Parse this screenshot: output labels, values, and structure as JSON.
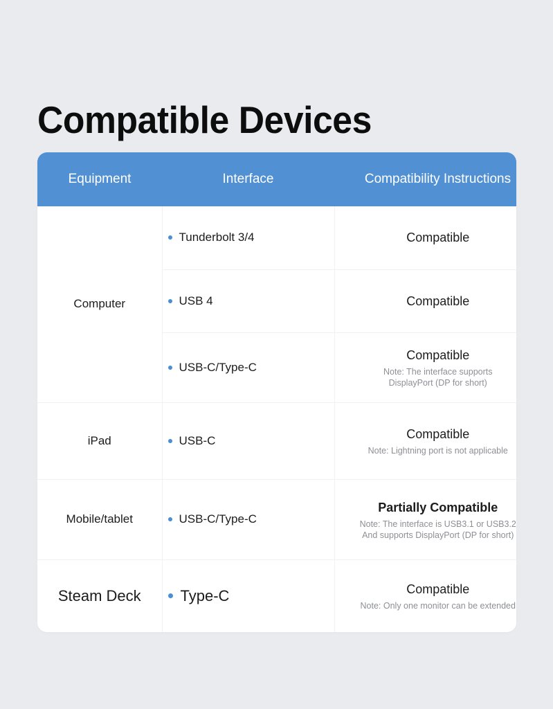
{
  "page": {
    "title": "Compatible Devices",
    "background_color": "#e9ebef"
  },
  "table": {
    "accent_color": "#5090d3",
    "bullet_color": "#4a8fd4",
    "note_color": "#8d8f94",
    "headers": {
      "equipment": "Equipment",
      "interface": "Interface",
      "compatibility": "Compatibility Instructions"
    },
    "rows": [
      {
        "equipment": "Computer",
        "equipment_rowspan": 3,
        "interfaces": [
          {
            "bullet": "bullet-icon",
            "interface": "Tunderbolt 3/4",
            "status": "Compatible",
            "note": ""
          },
          {
            "bullet": "bullet-icon",
            "interface": "USB 4",
            "status": "Compatible",
            "note": ""
          },
          {
            "bullet": "bullet-icon",
            "interface": "USB-C/Type-C",
            "status": "Compatible",
            "note": "Note: The interface supports\nDisplayPort (DP for short)"
          }
        ]
      },
      {
        "equipment": "iPad",
        "equipment_rowspan": 1,
        "interfaces": [
          {
            "bullet": "bullet-icon",
            "interface": "USB-C",
            "status": "Compatible",
            "note": "Note: Lightning port is not applicable"
          }
        ]
      },
      {
        "equipment": "Mobile/tablet",
        "equipment_rowspan": 1,
        "interfaces": [
          {
            "bullet": "bullet-icon",
            "interface": "USB-C/Type-C",
            "status": "Partially Compatible",
            "status_emphasis": "bold",
            "note": "Note: The interface is USB3.1 or USB3.2\nAnd supports DisplayPort (DP for short)"
          }
        ]
      },
      {
        "equipment": "Steam Deck",
        "equipment_rowspan": 1,
        "size": "large",
        "interfaces": [
          {
            "bullet": "bullet-icon",
            "interface": "Type-C",
            "status": "Compatible",
            "note": "Note: Only one monitor can be extended"
          }
        ]
      }
    ]
  }
}
